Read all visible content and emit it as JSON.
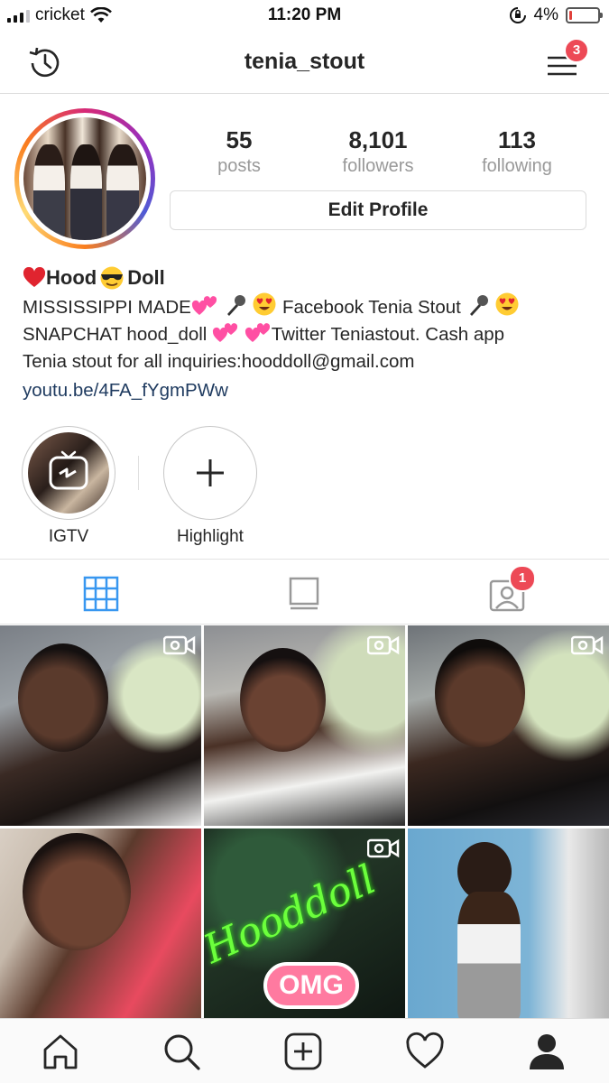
{
  "status_bar": {
    "carrier": "cricket",
    "time": "11:20 PM",
    "battery": "4%"
  },
  "nav": {
    "username": "tenia_stout",
    "menu_badge": "3"
  },
  "stats": [
    {
      "number": "55",
      "label": "posts"
    },
    {
      "number": "8,101",
      "label": "followers"
    },
    {
      "number": "113",
      "label": "following"
    }
  ],
  "edit_profile_label": "Edit Profile",
  "bio": {
    "name_part1": "Hood",
    "name_part2": "Doll",
    "line1a": "MISSISSIPPI MADE",
    "line1b": "Facebook Tenia Stout",
    "line2a": "SNAPCHAT hood_doll",
    "line2b": "Twitter Teniastout. Cash app",
    "line3": "Tenia stout for all inquiries:hooddoll@gmail.com",
    "link": "youtu.be/4FA_fYgmPWw"
  },
  "highlights": [
    {
      "label": "IGTV"
    },
    {
      "label": "Highlight"
    }
  ],
  "tabs_badge": "1",
  "grid_overlay_text": {
    "script": "Hooddoll",
    "sticker": "OMG"
  },
  "colors": {
    "accent": "#3897f0",
    "badge": "#ed4956",
    "link": "#1e3a5f"
  }
}
